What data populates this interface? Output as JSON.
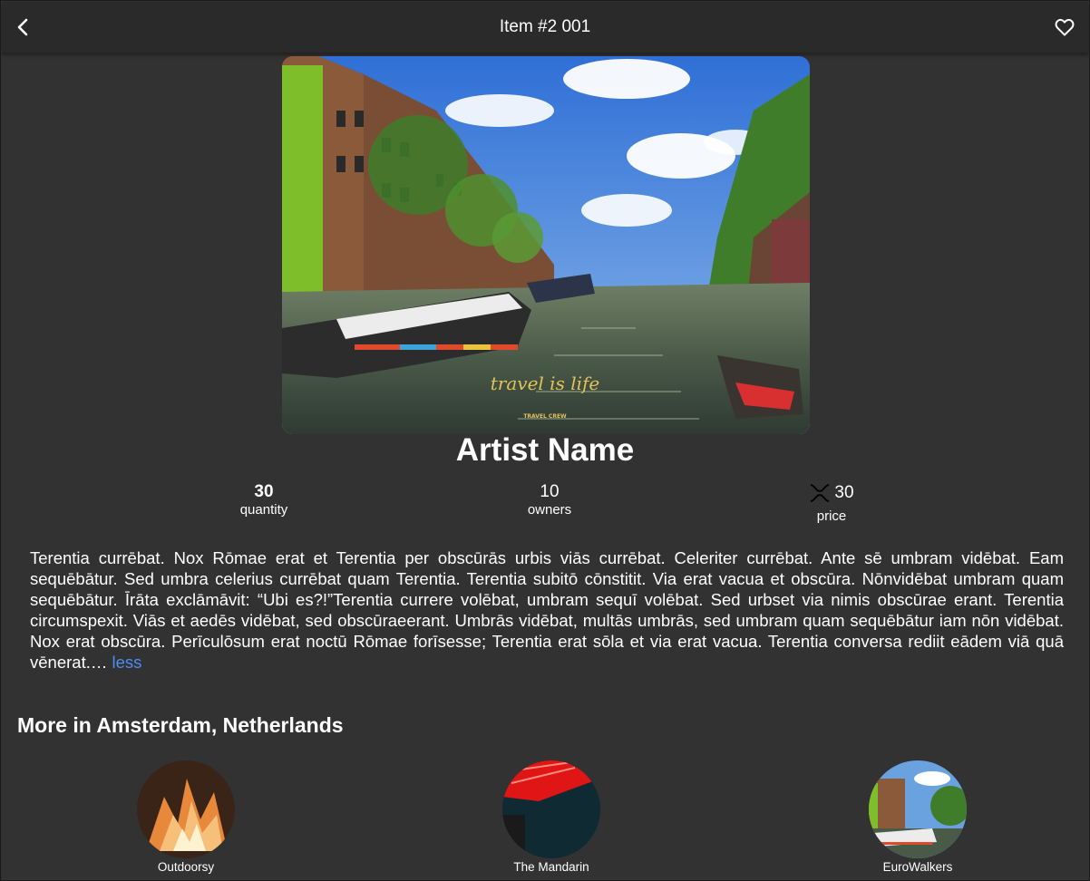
{
  "header": {
    "title": "Item #2 001",
    "back_icon": "chevron-left-icon",
    "favorite_icon": "heart-outline-icon"
  },
  "hero": {
    "image": "canal-photo",
    "watermark_script": "travel is life",
    "watermark_caption": "TRAVEL CREW"
  },
  "artist": {
    "name": "Artist Name"
  },
  "stats": {
    "quantity": {
      "value": "30",
      "label": "quantity"
    },
    "owners": {
      "value": "10",
      "label": "owners"
    },
    "price": {
      "value": "30",
      "label": "price",
      "icon": "xrp-currency-icon"
    }
  },
  "description": {
    "text": "Terentia currēbat. Nox Rōmae erat et Terentia per obscūrās urbis viās currēbat. Celeriter currēbat. Ante sē umbram vidēbat. Eam sequēbātur. Sed umbra celerius currēbat quam Terentia. Terentia subitō cōnstitit. Via erat vacua et obscūra. Nōnvidēbat umbram quam sequēbātur. Īrāta exclāmāvit: “Ubi es?!”Terentia currere volēbat, umbram sequī volēbat. Sed urbset via nimis obscūrae erant. Terentia circumspexit. Viās et aedēs vidēbat, sed obscūraeerant. Umbrās vidēbat, multās umbrās, sed umbram quam sequēbātur iam nōn vidēbat. Nox erat obscūra. Perīculōsum erat noctū Rōmae forīsesse; Terentia erat sōla et via erat vacua. Terentia conversa rediit eādem viā quā vēnerat.…",
    "toggle_label": "less"
  },
  "more": {
    "title": "More in Amsterdam, Netherlands",
    "items": [
      {
        "name": "Outdoorsy"
      },
      {
        "name": "The Mandarin"
      },
      {
        "name": "EuroWalkers"
      }
    ]
  },
  "colors": {
    "background": "#323232",
    "topbar": "#2a2a2a",
    "link": "#4e8df0",
    "text": "#ffffff"
  }
}
